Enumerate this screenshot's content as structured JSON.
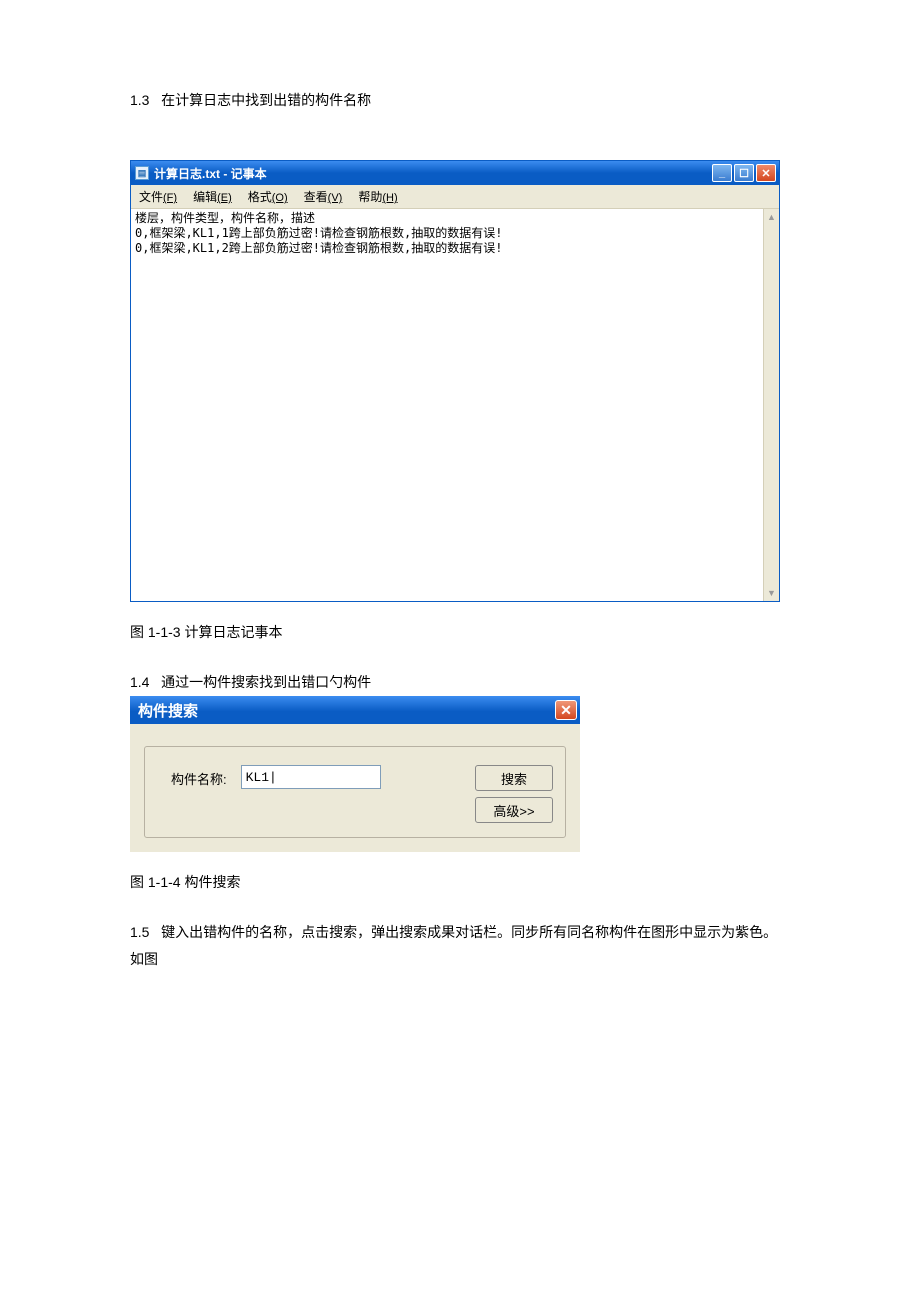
{
  "section_1_3": {
    "num": "1.3",
    "text": "在计算日志中找到出错的构件名称"
  },
  "notepad": {
    "title": "计算日志.txt - 记事本",
    "menu": {
      "file": {
        "label": "文件",
        "acc": "(F)"
      },
      "edit": {
        "label": "编辑",
        "acc": "(E)"
      },
      "format": {
        "label": "格式",
        "acc": "(O)"
      },
      "view": {
        "label": "查看",
        "acc": "(V)"
      },
      "help": {
        "label": "帮助",
        "acc": "(H)"
      }
    },
    "content": "楼层，构件类型，构件名称，描述\n0,框架梁,KL1,1跨上部负筋过密!请检查钢筋根数,抽取的数据有误!\n0,框架梁,KL1,2跨上部负筋过密!请检查钢筋根数,抽取的数据有误!"
  },
  "caption_1_1_3": "图 1-1-3 计算日志记事本",
  "section_1_4": {
    "num": "1.4",
    "text": "通过一构件搜索找到出错口勺构件"
  },
  "search_dialog": {
    "title": "构件搜索",
    "label": "构件名称:",
    "value": "KL1|",
    "btn_search": "搜索",
    "btn_advanced": "高级>>"
  },
  "caption_1_1_4": "图 1-1-4 构件搜索",
  "section_1_5": {
    "num": "1.5",
    "text": "键入出错构件的名称，点击搜索，弹出搜索成果对话栏。同步所有同名称构件在图形中显示为紫色。",
    "text2": "如图"
  }
}
